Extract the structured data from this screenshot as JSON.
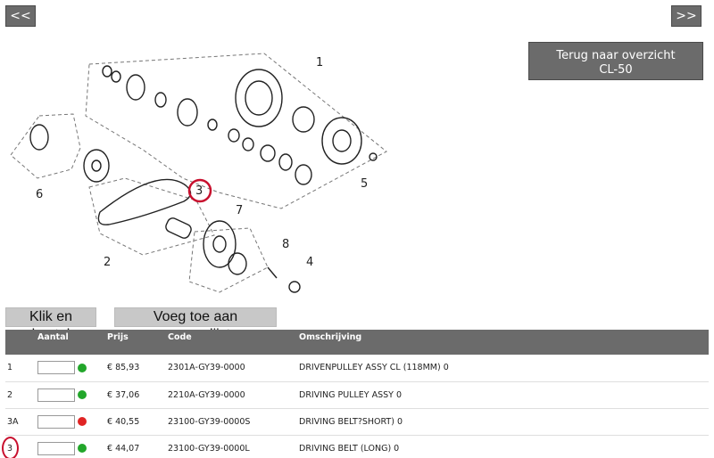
{
  "nav": {
    "prev": "<<",
    "next": ">>"
  },
  "back_button": {
    "line1": "Terug naar overzicht",
    "line2": "CL-50"
  },
  "diagram": {
    "callouts": [
      "1",
      "2",
      "3",
      "4",
      "5",
      "6",
      "7",
      "8"
    ],
    "highlighted": "3",
    "highlight_color": "#c8102e"
  },
  "actions": {
    "order": "Klik en bestel",
    "wishlist": "Voeg toe aan wensenlijst"
  },
  "table": {
    "headers": {
      "ref": "",
      "qty": "Aantal",
      "price": "Prijs",
      "code": "Code",
      "desc": "Omschrijving"
    },
    "rows": [
      {
        "ref": "1",
        "price": "€ 85,93",
        "code": "2301A-GY39-0000",
        "desc": "DRIVENPULLEY ASSY CL (118MM) 0",
        "status": "available"
      },
      {
        "ref": "2",
        "price": "€ 37,06",
        "code": "2210A-GY39-0000",
        "desc": "DRIVING PULLEY ASSY 0",
        "status": "available"
      },
      {
        "ref": "3A",
        "price": "€ 40,55",
        "code": "23100-GY39-0000S",
        "desc": "DRIVING BELT?SHORT) 0",
        "status": "unavailable"
      },
      {
        "ref": "3",
        "price": "€ 44,07",
        "code": "23100-GY39-0000L",
        "desc": "DRIVING BELT (LONG) 0",
        "status": "available"
      }
    ]
  },
  "colors": {
    "header_bg": "#6b6b6b",
    "available": "#22a62a",
    "unavailable": "#e02424"
  }
}
